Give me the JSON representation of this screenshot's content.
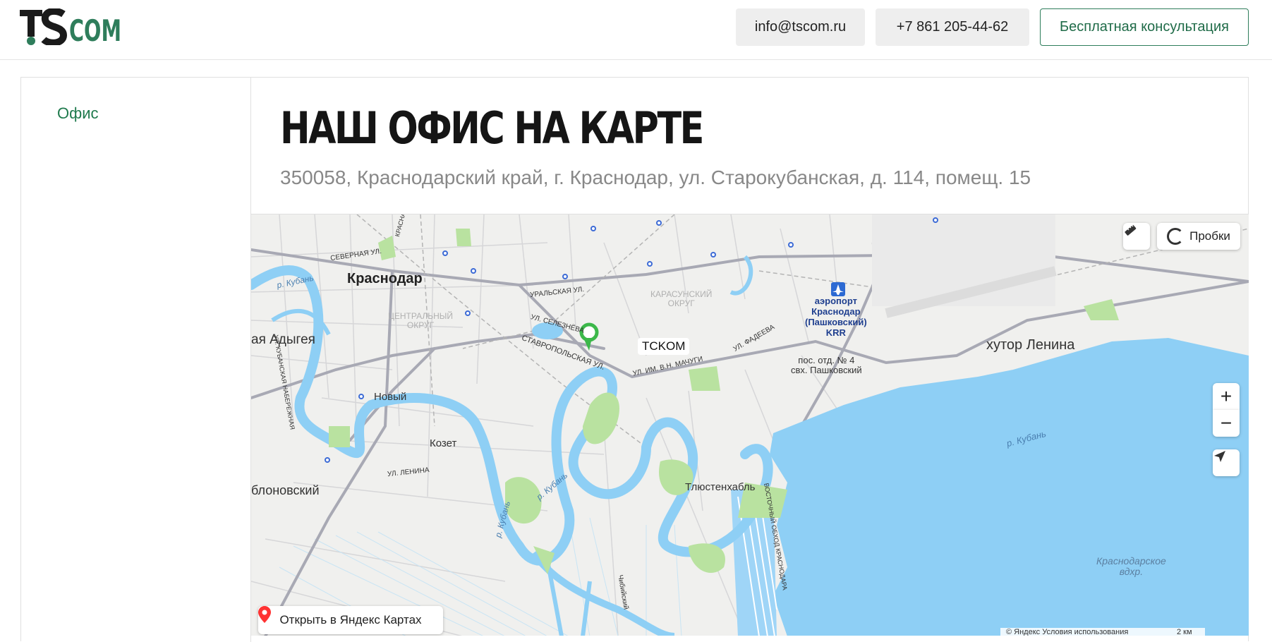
{
  "header": {
    "email": "info@tscom.ru",
    "phone": "+7 861 205-44-62",
    "consult_label": "Бесплатная консультация",
    "logo_text": "TSCOM"
  },
  "sidebar": {
    "items": [
      {
        "label": "Офис"
      }
    ]
  },
  "main": {
    "title": "НАШ ОФИС НА КАРТЕ",
    "address": "350058, Краснодарский край, г. Краснодар, ул. Старокубанская, д. 114, помещ. 15"
  },
  "map": {
    "traffic_label": "Пробки",
    "zoom_in": "+",
    "zoom_out": "−",
    "open_label": "Открыть в Яндекс Картах",
    "copyright": "© Яндекс  Условия использования",
    "scale": "2 км",
    "pin_label": "TCKOM",
    "labels": {
      "krasnodar": "Краснодар",
      "adygea": "ая Адыгея",
      "novy": "Новый",
      "kozet": "Козет",
      "yablonovsky": "блоновский",
      "tlyustenkhabl": "Тлюстенхабль",
      "khutor_lenina": "хутор Ленина",
      "airport": "аэропорт\nКраснодар\n(Пашковский)\nKRR",
      "pos_otd": "пос. отд. № 4\nсвх. Пашковский",
      "central": "ЦЕНТРАЛЬНЫЙ\nОКРУГ",
      "karasun": "КАРАСУНСКИЙ\nОКРУГ",
      "reservoir": "Краснодарское\nвдхр.",
      "r_kuban_1": "р. Кубань",
      "r_kuban_2": "р. Кубань",
      "r_kuban_3": "р. Кубань",
      "r_kuban_4": "р. Кубань",
      "severnaya": "СЕВЕРНАЯ УЛ.",
      "uralskaya": "УРАЛЬСКАЯ УЛ.",
      "stavropolskaya": "СТАВРОПОЛЬСКАЯ УЛ.",
      "selezneva": "УЛ. СЕЛЕЗНЁВА",
      "machugi": "УЛ. ИМ. В.Н. МАЧУГИ",
      "fadeeva": "УЛ. ФАДЕЕВА",
      "lenina": "УЛ. ЛЕНИНА",
      "kubanskaya_nab": "УЛ. КУБАНСКАЯ НАБЕРЕЖНАЯ",
      "krasnaya": "КРАСНАЯ УЛ.",
      "uralskaya_v": "ВОСТОЧНЫЙ ОБХОД КРАСНОДАРА",
      "chibiy": "Чибийский"
    }
  },
  "colors": {
    "brand_green": "#2e7d5b",
    "water": "#8ecff5",
    "park": "#b9e2a0"
  }
}
